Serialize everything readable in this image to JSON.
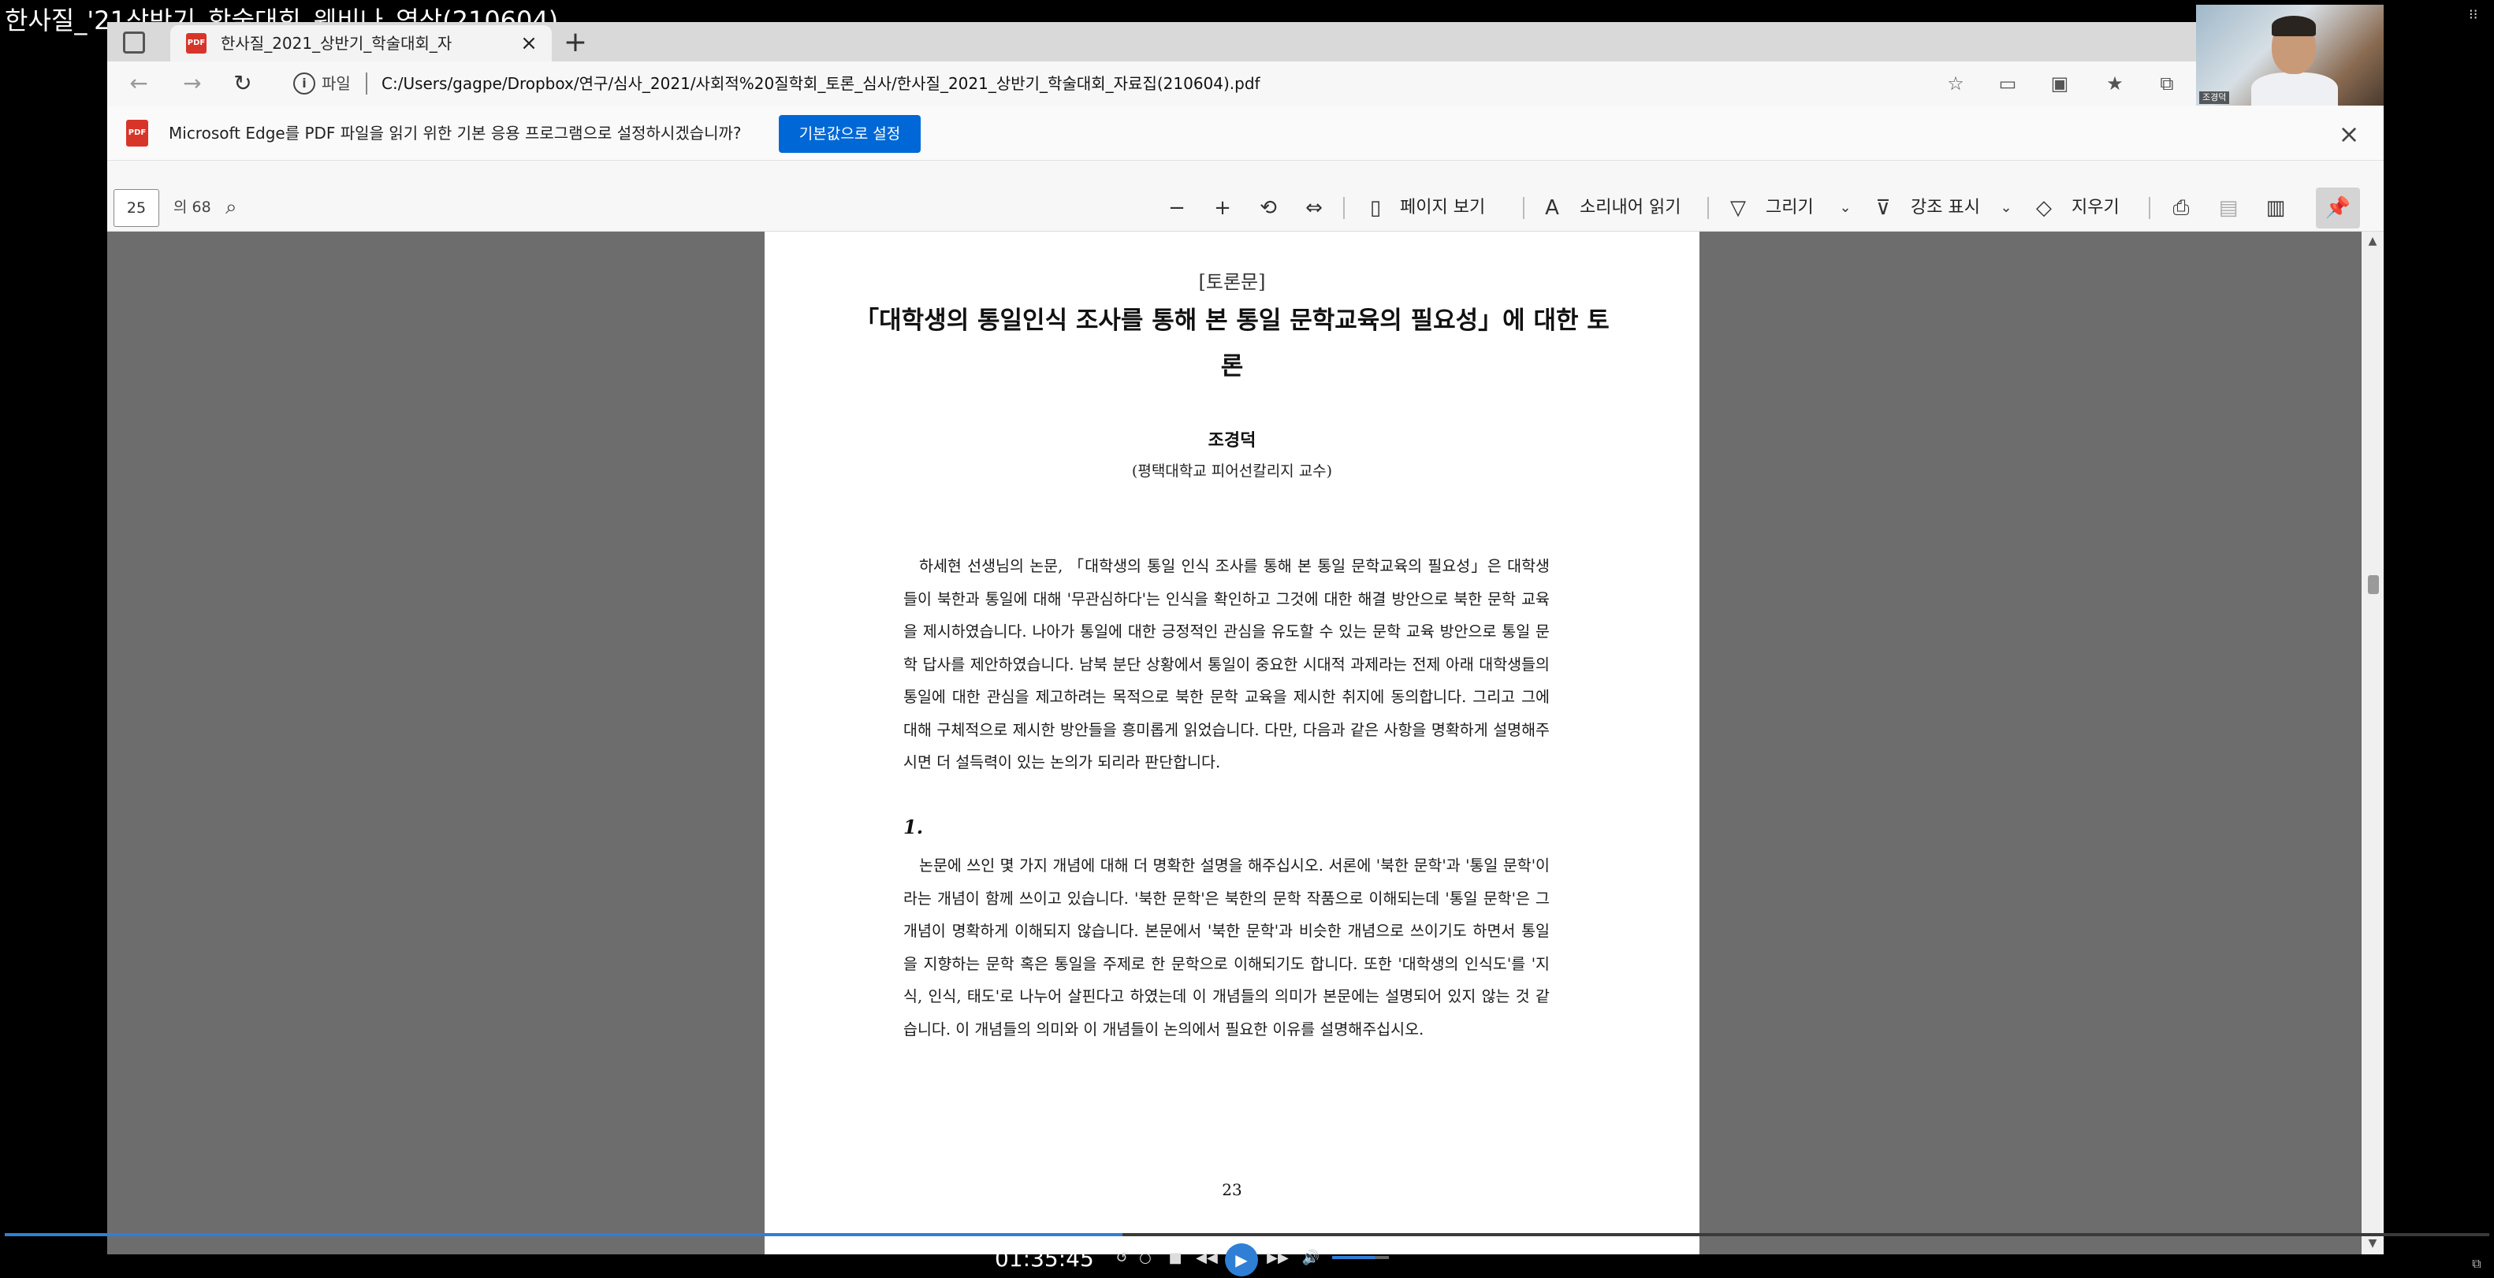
{
  "video": {
    "title": "한사질_'21상반기_학술대회_웨비나_영상(210604)",
    "time": "01:35:45",
    "progress_fraction": 0.45,
    "volume_fraction": 0.75
  },
  "browser": {
    "tab": {
      "title": "한사질_2021_상반기_학술대회_자",
      "favicon_text": "PDF"
    },
    "address": {
      "scheme_label": "파일",
      "url": "C:/Users/gagpe/Dropbox/연구/심사_2021/사회적%20질학회_토론_심사/한사질_2021_상반기_학술대회_자료집(210604).pdf"
    },
    "notification": {
      "icon_text": "PDF",
      "message": "Microsoft Edge를 PDF 파일을 읽기 위한 기본 응용 프로그램으로 설정하시겠습니까?",
      "button": "기본값으로 설정"
    },
    "pdf_toolbar": {
      "page_current": "25",
      "page_total": "의 68",
      "page_view": "페이지 보기",
      "read_aloud": "소리내어 읽기",
      "draw": "그리기",
      "highlight": "강조 표시",
      "erase": "지우기"
    }
  },
  "document": {
    "label": "[토론문]",
    "title": "「대학생의 통일인식 조사를 통해 본 통일 문학교육의 필요성」에 대한 토론",
    "author": "조경덕",
    "affiliation": "(평택대학교 피어선칼리지 교수)",
    "paragraph_1": "하세현 선생님의 논문, 「대학생의 통일 인식 조사를 통해 본 통일 문학교육의 필요성」은 대학생들이 북한과 통일에 대해 '무관심하다'는 인식을 확인하고 그것에 대한 해결 방안으로 북한 문학 교육을 제시하였습니다. 나아가 통일에 대한 긍정적인 관심을 유도할 수 있는 문학 교육 방안으로 통일 문학 답사를 제안하였습니다. 남북 분단 상황에서 통일이 중요한 시대적 과제라는 전제 아래 대학생들의 통일에 대한 관심을 제고하려는 목적으로 북한 문학 교육을 제시한 취지에 동의합니다. 그리고 그에 대해 구체적으로 제시한 방안들을 흥미롭게 읽었습니다. 다만, 다음과 같은 사항을 명확하게 설명해주시면 더 설득력이 있는 논의가 되리라 판단합니다.",
    "section_1": "1.",
    "paragraph_2": "논문에 쓰인 몇 가지 개념에 대해 더 명확한 설명을 해주십시오. 서론에 '북한 문학'과 '통일 문학'이라는 개념이 함께 쓰이고 있습니다. '북한 문학'은 북한의 문학 작품으로 이해되는데 '통일 문학'은 그 개념이 명확하게 이해되지 않습니다. 본문에서 '북한 문학'과 비슷한 개념으로 쓰이기도 하면서 통일을 지향하는 문학 혹은 통일을 주제로 한 문학으로 이해되기도 합니다. 또한 '대학생의 인식도'를 '지식, 인식, 태도'로 나누어 살핀다고 하였는데 이 개념들의 의미가 본문에는 설명되어 있지 않는 것 같습니다. 이 개념들의 의미와 이 개념들이 논의에서 필요한 이유를 설명해주십시오.",
    "page_number": "23"
  },
  "webcam": {
    "name": "조경덕"
  },
  "icons": {
    "back": "back-arrow-icon",
    "forward": "forward-arrow-icon",
    "refresh": "refresh-icon",
    "info": "info-icon",
    "favorites_add": "add-favorite-icon",
    "pin": "pin-icon"
  },
  "colors": {
    "accent": "#0068d6",
    "viewer_bg": "#6d6d6d",
    "player_accent": "#2f7fd6"
  }
}
